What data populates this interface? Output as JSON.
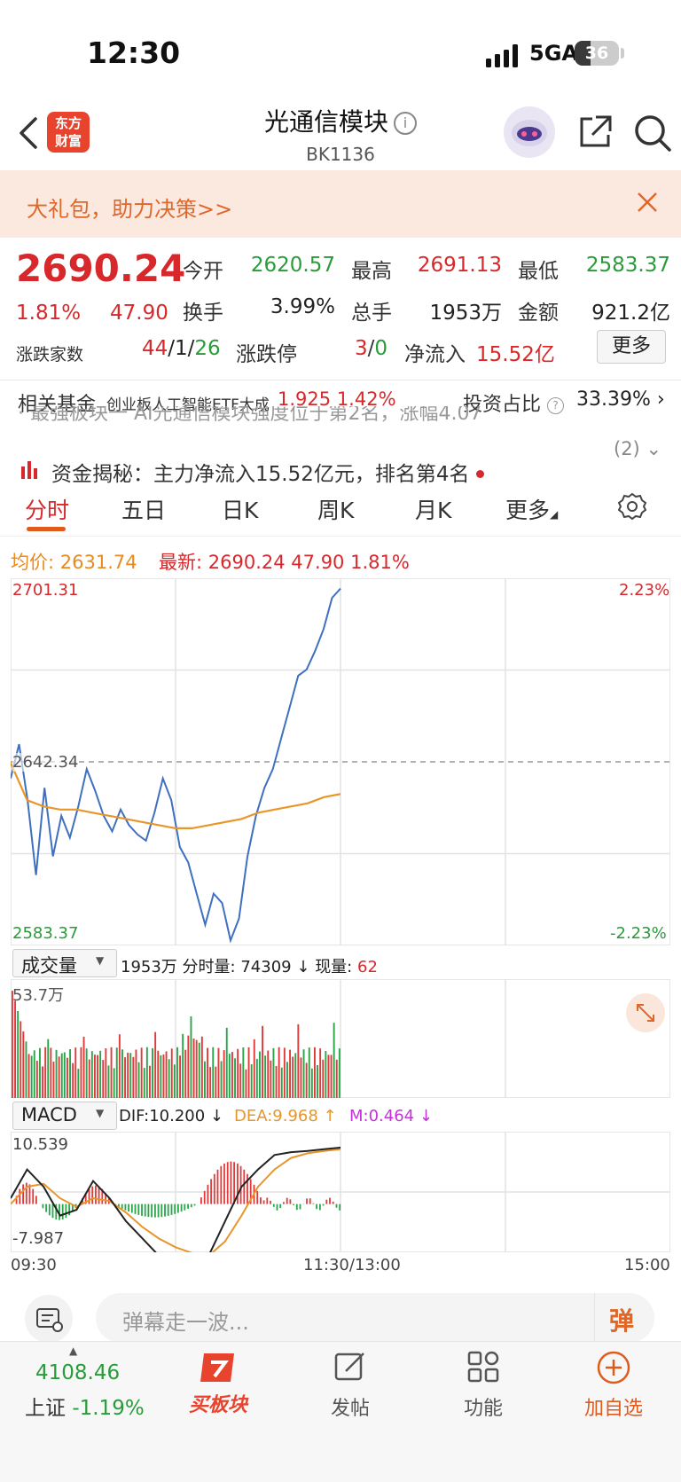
{
  "status": {
    "time": "12:30",
    "network": "5GA",
    "battery": "36",
    "battery_level_pct": 36
  },
  "header": {
    "title": "光通信模块",
    "code": "BK1136",
    "logo_line1": "东方",
    "logo_line2": "财富"
  },
  "promo": {
    "text": "大礼包，助力决策>>"
  },
  "quote": {
    "price": "2690.24",
    "pct": "1.81%",
    "chg": "47.90",
    "open_label": "今开",
    "open": "2620.57",
    "high_label": "最高",
    "high": "2691.13",
    "low_label": "最低",
    "low": "2583.37",
    "turnover_label": "换手",
    "turnover": "3.99%",
    "volume_label": "总手",
    "volume": "1953万",
    "amount_label": "金额",
    "amount": "921.2亿",
    "updown_label": "涨跌家数",
    "up": "44",
    "flat": "1",
    "down": "26",
    "limit_label": "涨跌停",
    "limit_up": "3",
    "limit_down": "0",
    "inflow_label": "净流入",
    "inflow": "15.52亿",
    "more_label": "更多"
  },
  "fund": {
    "label": "相关基金",
    "name": "创业板人工智能ETF大成",
    "price": "1.925",
    "pct": "1.42%",
    "invest_label": "投资占比",
    "invest_val": "33.39%"
  },
  "news": {
    "line1": "· 最强板块一 AI光通信模块强度位于第2名，涨幅4.07",
    "line2": "资金揭秘：主力净流入15.52亿元，排名第4名",
    "count": "(2)"
  },
  "tabs": [
    {
      "label": "分时"
    },
    {
      "label": "五日"
    },
    {
      "label": "日K"
    },
    {
      "label": "周K"
    },
    {
      "label": "月K"
    },
    {
      "label": "更多"
    }
  ],
  "intraday": {
    "avg_label": "均价:",
    "avg": "2631.74",
    "last_label": "最新:",
    "last": "2690.24",
    "chg": "47.90",
    "pct": "1.81%",
    "ymax": "2701.31",
    "ymid": "2642.34",
    "ymin": "2583.37",
    "pmax": "2.23%",
    "pmin": "-2.23%"
  },
  "volume": {
    "selector": "成交量",
    "total": "1953万",
    "tick_label": "分时量:",
    "tick": "74309",
    "tick_arrow": "↓",
    "now_label": "现量:",
    "now": "62",
    "max": "53.7万"
  },
  "macd": {
    "selector": "MACD",
    "dif": "DIF:10.200 ↓",
    "dea": "DEA:9.968 ↑",
    "m": "M:0.464 ↓",
    "max": "10.539",
    "min": "-7.987"
  },
  "time_axis": {
    "start": "09:30",
    "mid": "11:30/13:00",
    "end": "15:00"
  },
  "comment": {
    "placeholder": "弹幕走一波...",
    "danmu": "弹"
  },
  "bottom": {
    "index_value": "4108.46",
    "index_name": "上证",
    "index_pct": "-1.19%",
    "buy": "买板块",
    "post": "发帖",
    "func": "功能",
    "add": "加自选"
  },
  "chart_data": [
    {
      "type": "line",
      "title": "",
      "xlabel": "",
      "ylabel": "",
      "x": [
        "09:30",
        "11:30/13:00",
        "15:00"
      ],
      "ylim": [
        2583.37,
        2701.31
      ],
      "series": [
        {
          "name": "",
          "color": "#3f6fc0",
          "values": [
            2637,
            2648,
            2630,
            2606,
            2634,
            2612,
            2625,
            2618,
            2628,
            2640,
            2633,
            2625,
            2620,
            2627,
            2622,
            2619,
            2617,
            2626,
            2637,
            2630,
            2615,
            2610,
            2600,
            2590,
            2600,
            2597,
            2585,
            2592,
            2612,
            2625,
            2634,
            2640,
            2650,
            2660,
            2670,
            2672,
            2678,
            2685,
            2695,
            2698
          ]
        },
        {
          "name": "均价",
          "color": "#e8962a",
          "values": [
            2642,
            2630,
            2628,
            2627,
            2627,
            2626,
            2625,
            2624,
            2623,
            2622,
            2621,
            2621,
            2622,
            2623,
            2624,
            2626,
            2627,
            2628,
            2629,
            2631,
            2632
          ]
        }
      ]
    }
  ]
}
